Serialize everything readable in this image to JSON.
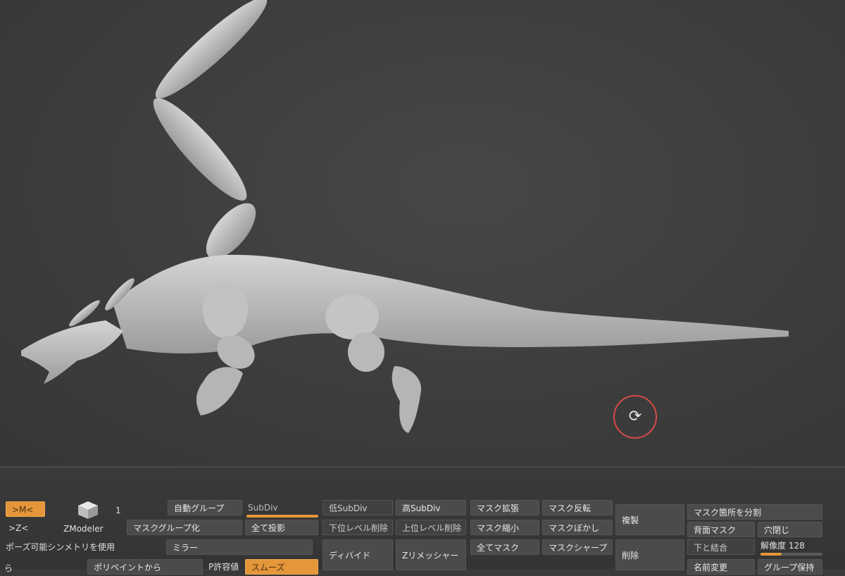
{
  "buttons": {
    "mode_m": ">M<",
    "mode_z": ">Z<",
    "partial": "ら",
    "tool_count": "1",
    "tool_name": "ZModeler",
    "auto_group": "自動グループ",
    "subdiv": "SubDiv",
    "low_subdiv": "低SubDiv",
    "high_subdiv": "高SubDiv",
    "mask_grow": "マスク拡張",
    "mask_invert": "マスク反転",
    "duplicate": "複製",
    "split_masked": "マスク箇所を分割",
    "mask_group": "マスクグループ化",
    "project_all": "全て投影",
    "del_lower": "下位レベル削除",
    "del_higher": "上位レベル削除",
    "mask_shrink": "マスク縮小",
    "mask_blur": "マスクぼかし",
    "back_mask": "背面マスク",
    "close_holes": "穴閉じ",
    "pose_symmetry": "ポーズ可能シンメトリを使用",
    "mirror": "ミラー",
    "divide": "ディバイド",
    "zremesher": "Zリメッシャー",
    "mask_all": "全てマスク",
    "mask_sharpen": "マスクシャープ",
    "delete": "削除",
    "merge_down": "下と結合",
    "polypaint_from": "ポリペイントから",
    "p_tolerance": "P許容値",
    "smooth": "スムーズ",
    "rename": "名前変更",
    "group_keep": "グループ保持"
  },
  "resolution": {
    "label": "解像度 128",
    "value": 128
  },
  "colors": {
    "accent": "#e4963a",
    "widget_ring": "#d84a48",
    "model": "#bdbdbd"
  },
  "icons": {
    "rotate": "rotate-icon",
    "zmodeler": "cube-icon"
  }
}
